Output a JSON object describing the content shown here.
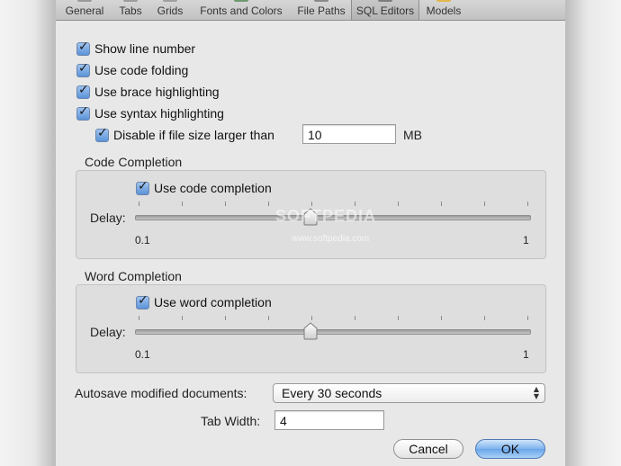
{
  "tabs": [
    {
      "label": "General"
    },
    {
      "label": "Tabs"
    },
    {
      "label": "Grids"
    },
    {
      "label": "Fonts and Colors"
    },
    {
      "label": "File Paths"
    },
    {
      "label": "SQL Editors"
    },
    {
      "label": "Models"
    }
  ],
  "editor": {
    "show_line_number": "Show line number",
    "use_code_folding": "Use code folding",
    "use_brace_highlighting": "Use brace highlighting",
    "use_syntax_highlighting": "Use syntax highlighting",
    "disable_if_larger": "Disable if file size larger than",
    "file_size_value": "10",
    "file_size_unit": "MB"
  },
  "code_completion": {
    "title": "Code Completion",
    "checkbox": "Use code completion",
    "delay_label": "Delay:",
    "min_label": "0.1",
    "max_label": "1",
    "delay_level": 0.44
  },
  "word_completion": {
    "title": "Word Completion",
    "checkbox": "Use word completion",
    "delay_label": "Delay:",
    "min_label": "0.1",
    "max_label": "1",
    "delay_level": 0.44
  },
  "autosave": {
    "label": "Autosave modified documents:",
    "value": "Every 30 seconds"
  },
  "tab_width": {
    "label": "Tab Width:",
    "value": "4"
  },
  "buttons": {
    "cancel": "Cancel",
    "ok": "OK"
  },
  "watermark": {
    "main": "SOFTPEDIA",
    "sub": "www.softpedia.com"
  },
  "colors": {
    "accent": "#6aa6ea",
    "window_bg": "#e8e8e8"
  }
}
